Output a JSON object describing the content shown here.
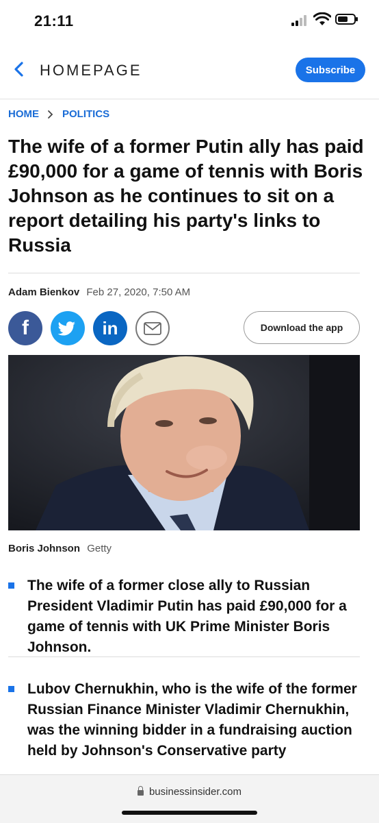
{
  "status_bar": {
    "time": "21:11"
  },
  "header": {
    "back_label": "HOMEPAGE",
    "subscribe_label": "Subscribe"
  },
  "breadcrumb": {
    "home": "HOME",
    "section": "POLITICS"
  },
  "article": {
    "headline": "The wife of a former Putin ally has paid £90,000 for a game of tennis with Boris Johnson as he continues to sit on a report detailing his party's links to Russia",
    "author": "Adam Bienkov",
    "date": "Feb 27, 2020, 7:50 AM",
    "download_label": "Download the app",
    "caption": {
      "name": "Boris Johnson",
      "credit": "Getty"
    },
    "bullets": [
      "The wife of a former close ally to Russian President Vladimir Putin has paid £90,000 for a game of tennis with UK Prime Minister Boris Johnson.",
      "Lubov Chernukhin, who is the wife of the former Russian Finance Minister Vladimir Chernukhin, was the winning bidder in a fundraising auction held by Johnson's Conservative party"
    ]
  },
  "share": {
    "facebook": "f",
    "linkedin": "in"
  },
  "url_bar": {
    "url": "businessinsider.com"
  },
  "colors": {
    "accent": "#1a73e8",
    "link": "#1a6cd6",
    "facebook": "#3b5998",
    "twitter": "#1da1f2",
    "linkedin": "#0a66c2"
  }
}
